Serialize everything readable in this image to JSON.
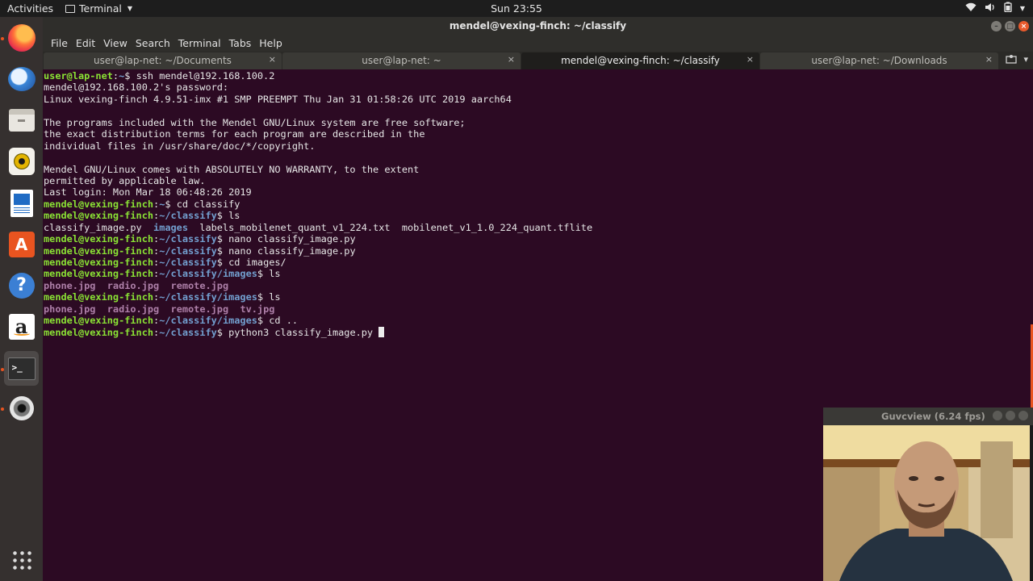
{
  "topbar": {
    "activities": "Activities",
    "app_name": "Terminal",
    "clock": "Sun 23:55"
  },
  "dock": {
    "items": [
      "firefox",
      "thunderbird",
      "files",
      "rhythmbox",
      "libreoffice-writer",
      "software-center",
      "help",
      "amazon",
      "terminal",
      "guvcview",
      "show-applications"
    ]
  },
  "window": {
    "title": "mendel@vexing-finch: ~/classify"
  },
  "menubar": {
    "items": [
      "File",
      "Edit",
      "View",
      "Search",
      "Terminal",
      "Tabs",
      "Help"
    ]
  },
  "tabs": [
    {
      "label": "user@lap-net: ~/Documents",
      "active": false
    },
    {
      "label": "user@lap-net: ~",
      "active": false
    },
    {
      "label": "mendel@vexing-finch: ~/classify",
      "active": true
    },
    {
      "label": "user@lap-net: ~/Downloads",
      "active": false
    }
  ],
  "terminal": {
    "lines": [
      [
        {
          "t": "user@lap-net",
          "c": "pu"
        },
        {
          "t": ":"
        },
        {
          "t": "~",
          "c": "pp"
        },
        {
          "t": "$ ssh mendel@192.168.100.2"
        }
      ],
      [
        {
          "t": "mendel@192.168.100.2's password:"
        }
      ],
      [
        {
          "t": "Linux vexing-finch 4.9.51-imx #1 SMP PREEMPT Thu Jan 31 01:58:26 UTC 2019 aarch64"
        }
      ],
      [
        {
          "t": ""
        }
      ],
      [
        {
          "t": "The programs included with the Mendel GNU/Linux system are free software;"
        }
      ],
      [
        {
          "t": "the exact distribution terms for each program are described in the"
        }
      ],
      [
        {
          "t": "individual files in /usr/share/doc/*/copyright."
        }
      ],
      [
        {
          "t": ""
        }
      ],
      [
        {
          "t": "Mendel GNU/Linux comes with ABSOLUTELY NO WARRANTY, to the extent"
        }
      ],
      [
        {
          "t": "permitted by applicable law."
        }
      ],
      [
        {
          "t": "Last login: Mon Mar 18 06:48:26 2019"
        }
      ],
      [
        {
          "t": "mendel@vexing-finch",
          "c": "pu"
        },
        {
          "t": ":"
        },
        {
          "t": "~",
          "c": "pp"
        },
        {
          "t": "$ cd classify"
        }
      ],
      [
        {
          "t": "mendel@vexing-finch",
          "c": "pu"
        },
        {
          "t": ":"
        },
        {
          "t": "~/classify",
          "c": "pp"
        },
        {
          "t": "$ ls"
        }
      ],
      [
        {
          "t": "classify_image.py  "
        },
        {
          "t": "images",
          "c": "dir"
        },
        {
          "t": "  labels_mobilenet_quant_v1_224.txt  mobilenet_v1_1.0_224_quant.tflite"
        }
      ],
      [
        {
          "t": "mendel@vexing-finch",
          "c": "pu"
        },
        {
          "t": ":"
        },
        {
          "t": "~/classify",
          "c": "pp"
        },
        {
          "t": "$ nano classify_image.py"
        }
      ],
      [
        {
          "t": "mendel@vexing-finch",
          "c": "pu"
        },
        {
          "t": ":"
        },
        {
          "t": "~/classify",
          "c": "pp"
        },
        {
          "t": "$ nano classify_image.py"
        }
      ],
      [
        {
          "t": "mendel@vexing-finch",
          "c": "pu"
        },
        {
          "t": ":"
        },
        {
          "t": "~/classify",
          "c": "pp"
        },
        {
          "t": "$ cd images/"
        }
      ],
      [
        {
          "t": "mendel@vexing-finch",
          "c": "pu"
        },
        {
          "t": ":"
        },
        {
          "t": "~/classify/images",
          "c": "pp"
        },
        {
          "t": "$ ls"
        }
      ],
      [
        {
          "t": "phone.jpg",
          "c": "jpg"
        },
        {
          "t": "  "
        },
        {
          "t": "radio.jpg",
          "c": "jpg"
        },
        {
          "t": "  "
        },
        {
          "t": "remote.jpg",
          "c": "jpg"
        }
      ],
      [
        {
          "t": "mendel@vexing-finch",
          "c": "pu"
        },
        {
          "t": ":"
        },
        {
          "t": "~/classify/images",
          "c": "pp"
        },
        {
          "t": "$ ls"
        }
      ],
      [
        {
          "t": "phone.jpg",
          "c": "jpg"
        },
        {
          "t": "  "
        },
        {
          "t": "radio.jpg",
          "c": "jpg"
        },
        {
          "t": "  "
        },
        {
          "t": "remote.jpg",
          "c": "jpg"
        },
        {
          "t": "  "
        },
        {
          "t": "tv.jpg",
          "c": "jpg"
        }
      ],
      [
        {
          "t": "mendel@vexing-finch",
          "c": "pu"
        },
        {
          "t": ":"
        },
        {
          "t": "~/classify/images",
          "c": "pp"
        },
        {
          "t": "$ cd .."
        }
      ],
      [
        {
          "t": "mendel@vexing-finch",
          "c": "pu"
        },
        {
          "t": ":"
        },
        {
          "t": "~/classify",
          "c": "pp"
        },
        {
          "t": "$ python3 classify_image.py "
        }
      ]
    ]
  },
  "guvcview": {
    "title": "Guvcview  (6.24 fps)"
  },
  "colors": {
    "terminal_bg": "#2c0a23",
    "prompt_user": "#8ae234",
    "prompt_path": "#729fcf",
    "image_file": "#ad7fa8",
    "accent": "#e95420"
  }
}
